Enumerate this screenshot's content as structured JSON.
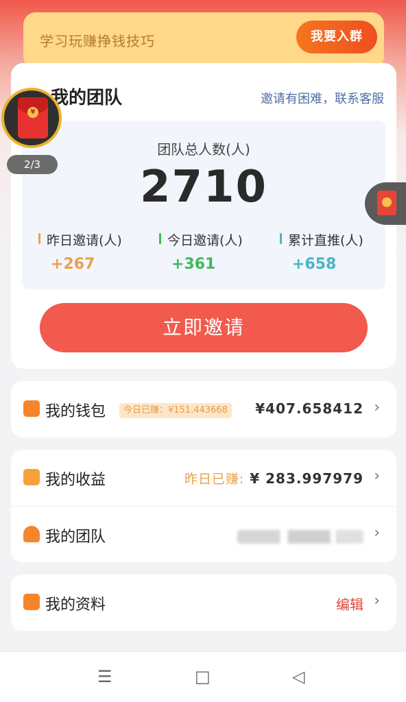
{
  "banner": {
    "text": "学习玩赚挣钱技巧",
    "button": "我要入群"
  },
  "team_card": {
    "title": "我的团队",
    "help_link": "邀请有困难，联系客服",
    "total_label": "团队总人数(人)",
    "total_value": "2710",
    "stats": [
      {
        "label": "昨日邀请(人)",
        "value": "+267",
        "color": "#e8a24a"
      },
      {
        "label": "今日邀请(人)",
        "value": "+361",
        "color": "#3fba5a"
      },
      {
        "label": "累计直推(人)",
        "value": "+658",
        "color": "#46b6c4"
      }
    ],
    "invite_button": "立即邀请"
  },
  "floating": {
    "left_counter": "2/3",
    "left_icon": "red-envelope-icon",
    "coin_symbol": "¥",
    "right_icon": "red-envelope-icon"
  },
  "wallet": {
    "title": "我的钱包",
    "badge": "今日已赚：¥151.443668",
    "amount": "¥407.658412",
    "icon": "wallet-icon",
    "icon_color": "#f5852b"
  },
  "earnings": {
    "title": "我的收益",
    "label": "昨日已赚:",
    "amount": "¥ 283.997979",
    "icon": "yen-box-icon",
    "icon_color": "#f5a23b"
  },
  "team_row": {
    "title": "我的团队",
    "icon": "person-icon",
    "icon_color": "#f5852b"
  },
  "profile": {
    "title": "我的资料",
    "edit": "编辑",
    "icon": "document-icon",
    "icon_color": "#f5852b"
  },
  "navbar": {
    "menu": "☰",
    "home": "□",
    "back": "◁"
  }
}
